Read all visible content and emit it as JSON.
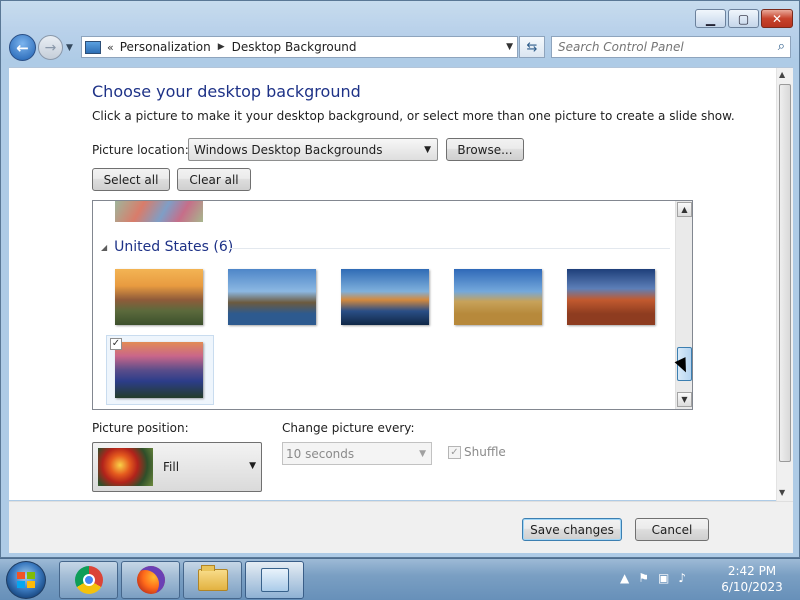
{
  "window": {
    "controls": {
      "minimize_icon": "minimize-icon",
      "maximize_icon": "maximize-icon",
      "close_icon": "close-icon"
    }
  },
  "address_bar": {
    "chevron": "«",
    "crumbs": [
      "Personalization",
      "Desktop Background"
    ]
  },
  "search": {
    "placeholder": "Search Control Panel"
  },
  "page": {
    "title": "Choose your desktop background",
    "description": "Click a picture to make it your desktop background, or select more than one picture to create a slide show.",
    "picture_location_label": "Picture location:",
    "picture_location_value": "Windows Desktop Backgrounds",
    "browse_label": "Browse...",
    "select_all_label": "Select all",
    "clear_all_label": "Clear all"
  },
  "gallery": {
    "group_title": "United States (6)",
    "selected_check": "✓"
  },
  "options": {
    "picture_position_label": "Picture position:",
    "picture_position_value": "Fill",
    "change_every_label": "Change picture every:",
    "change_every_value": "10 seconds",
    "shuffle_label": "Shuffle",
    "shuffle_check": "✓"
  },
  "footer": {
    "save_label": "Save changes",
    "cancel_label": "Cancel"
  },
  "taskbar": {
    "apps": [
      "chrome-icon",
      "firefox-icon",
      "explorer-folder-icon",
      "control-panel-icon"
    ],
    "tray_icons": [
      "show-hidden-icons-arrow",
      "action-center-flag-icon",
      "network-icon",
      "volume-muted-icon"
    ],
    "time": "2:42 PM",
    "date": "6/10/2023"
  }
}
